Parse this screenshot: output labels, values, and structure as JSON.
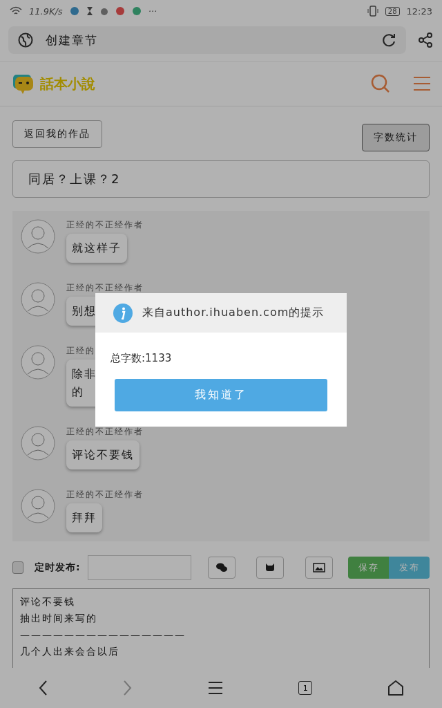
{
  "status_bar": {
    "network_speed": "11.9K/s",
    "more": "···",
    "battery": "28",
    "time": "12:23"
  },
  "address_bar": {
    "title": "创建章节"
  },
  "header": {
    "logo_text": "話本小說"
  },
  "back_button": "返回我的作品",
  "word_count_button": "字数统计",
  "chapter_title": {
    "value": "同居？上课？2"
  },
  "messages": [
    {
      "author": "正经的不正经作者",
      "lines": [
        "就这样子"
      ]
    },
    {
      "author": "正经的不正经作者",
      "lines": [
        "别想"
      ]
    },
    {
      "author": "正经的",
      "lines": [
        "除非",
        "的"
      ]
    },
    {
      "author": "正经的不正经作者",
      "lines": [
        "评论不要钱"
      ]
    },
    {
      "author": "正经的不正经作者",
      "lines": [
        "拜拜"
      ]
    }
  ],
  "toolbar": {
    "schedule": {
      "label": "定时发布:",
      "checked": false
    },
    "save": "保存",
    "publish": "发布"
  },
  "editor": {
    "lines": [
      "评论不要钱",
      "抽出时间来写的",
      "———————————————",
      "几个人出来会合以后"
    ]
  },
  "dialog": {
    "title": "来自author.ihuaben.com的提示",
    "message": "总字数:1133",
    "button": "我知道了"
  },
  "nav": {
    "tab_count": "1"
  }
}
